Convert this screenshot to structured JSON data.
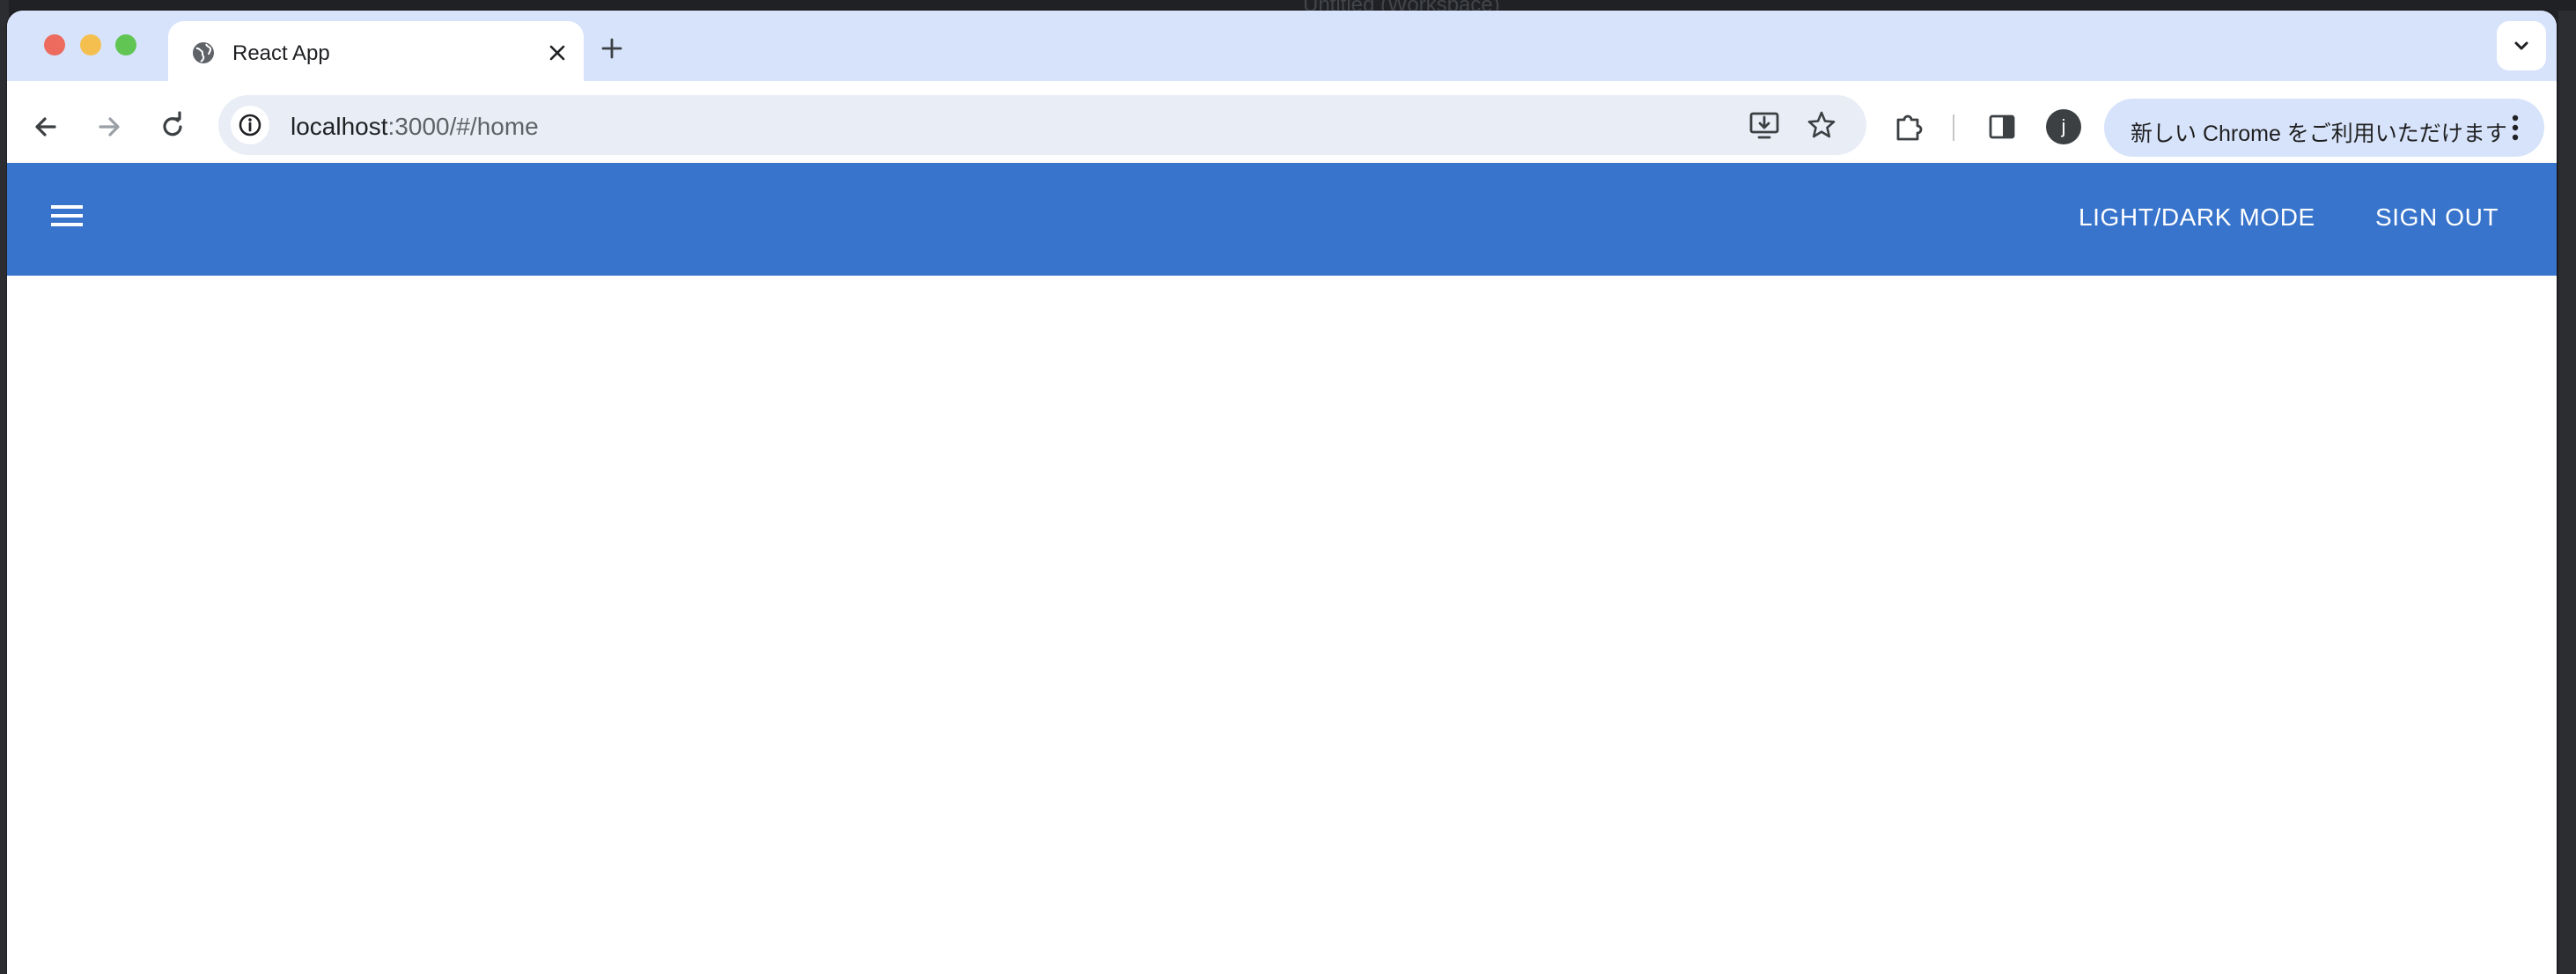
{
  "browser": {
    "tab": {
      "title": "React App",
      "favicon": "globe-icon"
    },
    "toolbar": {
      "url_host": "localhost",
      "url_path": ":3000/#/home",
      "profile_initial": "j",
      "promo_text": "新しい Chrome をご利用いただけます"
    },
    "colors": {
      "tabstrip": "#d7e3fb",
      "omnibox": "#e9edf6"
    }
  },
  "app": {
    "appbar": {
      "color": "#3874cb",
      "menu_icon": "menu-icon",
      "mode_label": "LIGHT/DARK MODE",
      "signout_label": "SIGN OUT"
    }
  },
  "desktop": {
    "window_title": "Untitled (Workspace)"
  }
}
